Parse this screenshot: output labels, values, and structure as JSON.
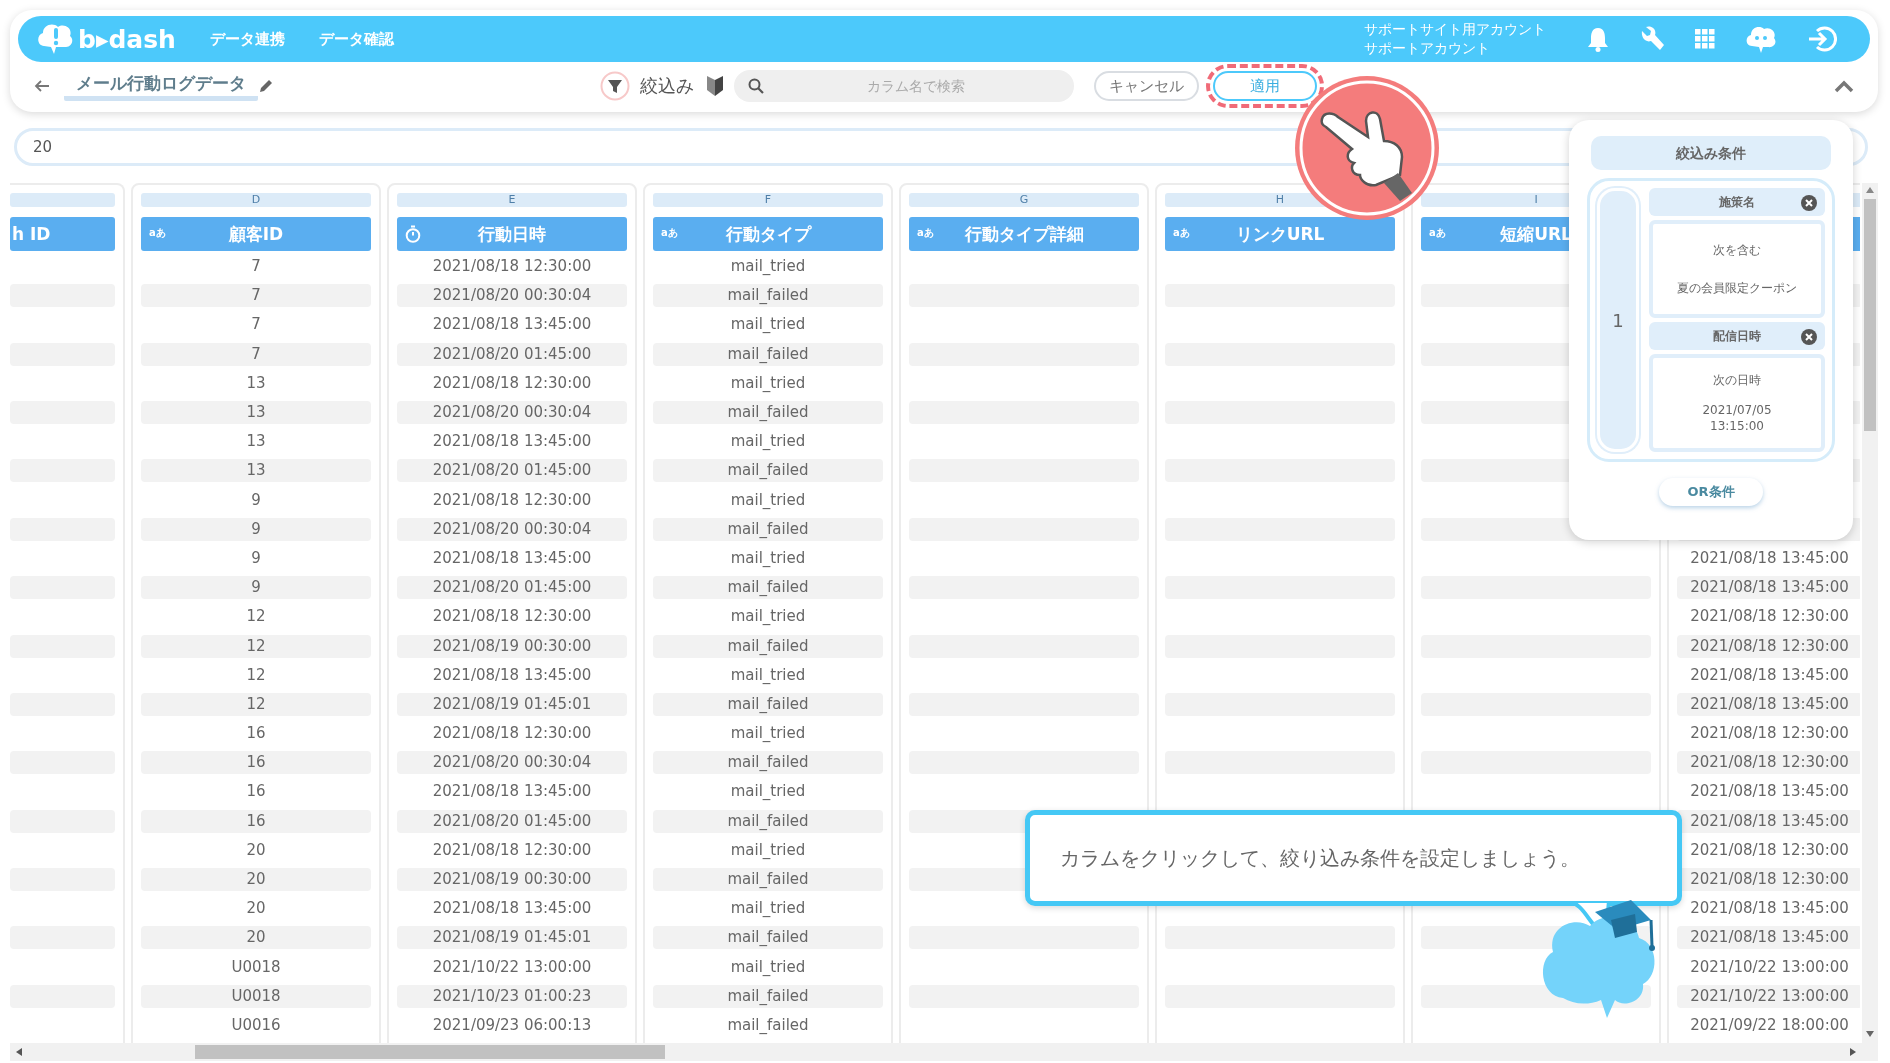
{
  "header": {
    "logo": "b▸dash",
    "nav": [
      {
        "label": "データ連携"
      },
      {
        "label": "データ確認"
      }
    ],
    "account": {
      "site": "サポートサイト用アカウント",
      "user": "サポートアカウント"
    }
  },
  "toolbar": {
    "title": "メール行動ログデータ",
    "filter_label": "絞込み",
    "search": {
      "placeholder": "カラム名で検索"
    },
    "buttons": [
      {
        "label": "キャンセル",
        "kind": "cancel",
        "highlighted": false
      },
      {
        "label": "適用",
        "kind": "apply",
        "highlighted": true
      }
    ]
  },
  "filter_input": {
    "value": "20"
  },
  "table": {
    "columns": [
      {
        "header": "h ID"
      },
      {
        "letter": "D",
        "kind": "text",
        "type_label": "aあ",
        "header": "顧客ID"
      },
      {
        "letter": "E",
        "kind": "datetime",
        "header": "行動日時"
      },
      {
        "letter": "F",
        "kind": "text",
        "type_label": "aあ",
        "header": "行動タイプ"
      },
      {
        "letter": "G",
        "kind": "text",
        "type_label": "aあ",
        "header": "行動タイプ詳細"
      },
      {
        "letter": "H",
        "kind": "text",
        "type_label": "aあ",
        "header": "リンクURL"
      },
      {
        "letter": "I",
        "kind": "text",
        "type_label": "aあ",
        "header": "短縮URL"
      },
      {}
    ],
    "rows": [
      {
        "customer_id": "7",
        "action_datetime": "2021/08/18 12:30:00",
        "action_type": "mail_tried"
      },
      {
        "customer_id": "7",
        "action_datetime": "2021/08/20 00:30:04",
        "action_type": "mail_failed"
      },
      {
        "customer_id": "7",
        "action_datetime": "2021/08/18 13:45:00",
        "action_type": "mail_tried"
      },
      {
        "customer_id": "7",
        "action_datetime": "2021/08/20 01:45:00",
        "action_type": "mail_failed"
      },
      {
        "customer_id": "13",
        "action_datetime": "2021/08/18 12:30:00",
        "action_type": "mail_tried"
      },
      {
        "customer_id": "13",
        "action_datetime": "2021/08/20 00:30:04",
        "action_type": "mail_failed"
      },
      {
        "customer_id": "13",
        "action_datetime": "2021/08/18 13:45:00",
        "action_type": "mail_tried"
      },
      {
        "customer_id": "13",
        "action_datetime": "2021/08/20 01:45:00",
        "action_type": "mail_failed"
      },
      {
        "customer_id": "9",
        "action_datetime": "2021/08/18 12:30:00",
        "action_type": "mail_tried"
      },
      {
        "customer_id": "9",
        "action_datetime": "2021/08/20 00:30:04",
        "action_type": "mail_failed"
      },
      {
        "customer_id": "9",
        "action_datetime": "2021/08/18 13:45:00",
        "action_type": "mail_tried",
        "column_8": "2021/08/18 13:45:00"
      },
      {
        "customer_id": "9",
        "action_datetime": "2021/08/20 01:45:00",
        "action_type": "mail_failed",
        "column_8": "2021/08/18 13:45:00"
      },
      {
        "customer_id": "12",
        "action_datetime": "2021/08/18 12:30:00",
        "action_type": "mail_tried",
        "column_8": "2021/08/18 12:30:00"
      },
      {
        "customer_id": "12",
        "action_datetime": "2021/08/19 00:30:00",
        "action_type": "mail_failed",
        "column_8": "2021/08/18 12:30:00"
      },
      {
        "customer_id": "12",
        "action_datetime": "2021/08/18 13:45:00",
        "action_type": "mail_tried",
        "column_8": "2021/08/18 13:45:00"
      },
      {
        "customer_id": "12",
        "action_datetime": "2021/08/19 01:45:01",
        "action_type": "mail_failed",
        "column_8": "2021/08/18 13:45:00"
      },
      {
        "customer_id": "16",
        "action_datetime": "2021/08/18 12:30:00",
        "action_type": "mail_tried",
        "column_8": "2021/08/18 12:30:00"
      },
      {
        "customer_id": "16",
        "action_datetime": "2021/08/20 00:30:04",
        "action_type": "mail_failed",
        "column_8": "2021/08/18 12:30:00"
      },
      {
        "customer_id": "16",
        "action_datetime": "2021/08/18 13:45:00",
        "action_type": "mail_tried",
        "column_8": "2021/08/18 13:45:00"
      },
      {
        "customer_id": "16",
        "action_datetime": "2021/08/20 01:45:00",
        "action_type": "mail_failed",
        "column_8": "2021/08/18 13:45:00"
      },
      {
        "customer_id": "20",
        "action_datetime": "2021/08/18 12:30:00",
        "action_type": "mail_tried",
        "column_8": "2021/08/18 12:30:00"
      },
      {
        "customer_id": "20",
        "action_datetime": "2021/08/19 00:30:00",
        "action_type": "mail_failed",
        "column_8": "2021/08/18 12:30:00"
      },
      {
        "customer_id": "20",
        "action_datetime": "2021/08/18 13:45:00",
        "action_type": "mail_tried",
        "column_8": "2021/08/18 13:45:00"
      },
      {
        "customer_id": "20",
        "action_datetime": "2021/08/19 01:45:01",
        "action_type": "mail_failed",
        "column_8": "2021/08/18 13:45:00"
      },
      {
        "customer_id": "U0018",
        "action_datetime": "2021/10/22 13:00:00",
        "action_type": "mail_tried",
        "column_8": "2021/10/22 13:00:00"
      },
      {
        "customer_id": "U0018",
        "action_datetime": "2021/10/23 01:00:23",
        "action_type": "mail_failed",
        "column_8": "2021/10/22 13:00:00"
      },
      {
        "customer_id": "U0016",
        "action_datetime": "2021/09/23 06:00:13",
        "action_type": "mail_failed",
        "column_8": "2021/09/22 18:00:00"
      }
    ]
  },
  "filter_panel": {
    "title": "絞込み条件",
    "groups": [
      {
        "number": "1",
        "conditions": [
          {
            "field": "施策名",
            "operator": "次を含む",
            "value": "夏の会員限定クーポン"
          },
          {
            "field": "配信日時",
            "operator": "次の日時",
            "value": "2021/07/05 13:15:00"
          }
        ]
      }
    ],
    "or_button": "OR条件"
  },
  "guide": {
    "message": "カラムをクリックして、絞り込み条件を設定しましょう。"
  }
}
